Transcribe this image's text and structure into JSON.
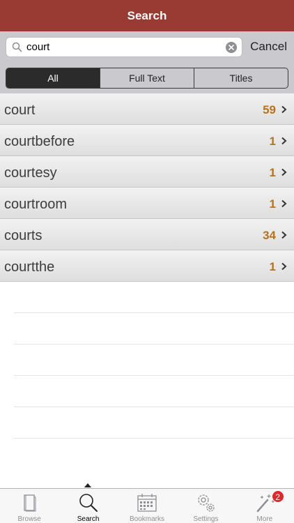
{
  "navbar": {
    "title": "Search"
  },
  "search": {
    "query": "court",
    "cancel_label": "Cancel"
  },
  "segments": [
    "All",
    "Full Text",
    "Titles"
  ],
  "results": [
    {
      "word": "court",
      "count": "59"
    },
    {
      "word": "courtbefore",
      "count": "1"
    },
    {
      "word": "courtesy",
      "count": "1"
    },
    {
      "word": "courtroom",
      "count": "1"
    },
    {
      "word": "courts",
      "count": "34"
    },
    {
      "word": "courtthe",
      "count": "1"
    }
  ],
  "tabbar": {
    "tabs": [
      {
        "label": "Browse",
        "icon": "book-icon"
      },
      {
        "label": "Search",
        "icon": "search-icon"
      },
      {
        "label": "Bookmarks",
        "icon": "calendar-icon"
      },
      {
        "label": "Settings",
        "icon": "gears-icon"
      },
      {
        "label": "More",
        "icon": "magic-wand-icon"
      }
    ],
    "more_badge": "2"
  },
  "colors": {
    "navbar": "#9a3b33",
    "count": "#b5731f",
    "badge": "#e0272a"
  }
}
